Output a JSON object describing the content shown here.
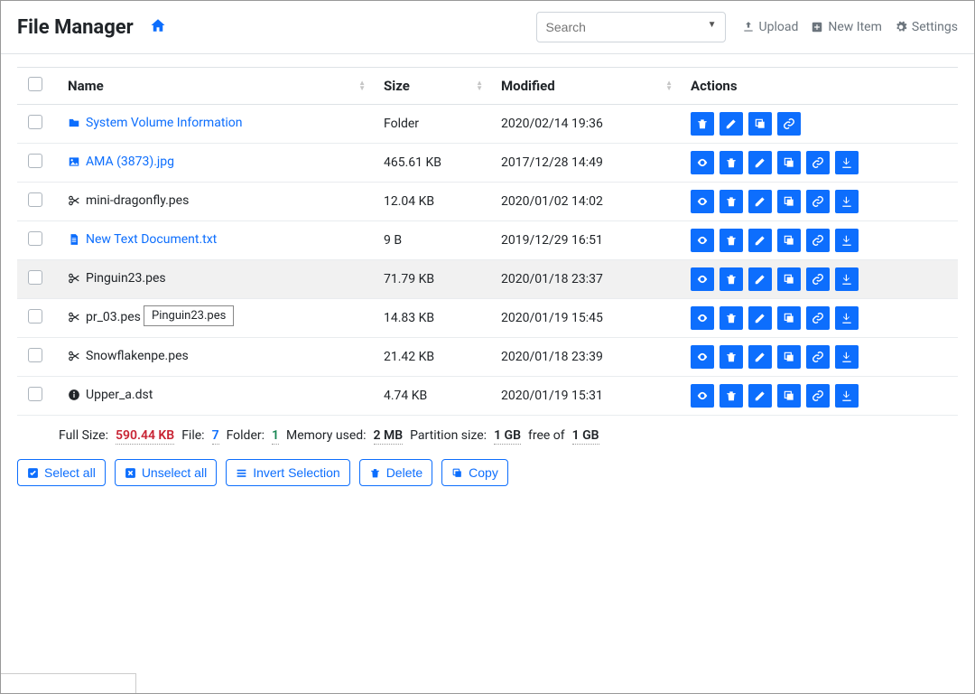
{
  "header": {
    "brand": "File Manager",
    "search_placeholder": "Search",
    "upload": "Upload",
    "new_item": "New Item",
    "settings": "Settings"
  },
  "columns": {
    "name": "Name",
    "size": "Size",
    "modified": "Modified",
    "actions": "Actions"
  },
  "rows": [
    {
      "icon": "folder",
      "link": true,
      "name": "System Volume Information",
      "size": "Folder",
      "modified": "2020/02/14 19:36",
      "actions": [
        "delete",
        "rename",
        "copy",
        "link"
      ]
    },
    {
      "icon": "image",
      "link": true,
      "name": "AMA (3873).jpg",
      "size": "465.61 KB",
      "modified": "2017/12/28 14:49",
      "actions": [
        "preview",
        "delete",
        "rename",
        "copy",
        "link",
        "download"
      ]
    },
    {
      "icon": "scissor",
      "link": false,
      "name": "mini-dragonfly.pes",
      "size": "12.04 KB",
      "modified": "2020/01/02 14:02",
      "actions": [
        "preview",
        "delete",
        "rename",
        "copy",
        "link",
        "download"
      ]
    },
    {
      "icon": "file",
      "link": true,
      "name": "New Text Document.txt",
      "size": "9 B",
      "modified": "2019/12/29 16:51",
      "actions": [
        "preview",
        "delete",
        "rename",
        "copy",
        "link",
        "download"
      ]
    },
    {
      "icon": "scissor",
      "link": false,
      "name": "Pinguin23.pes",
      "size": "71.79 KB",
      "modified": "2020/01/18 23:37",
      "actions": [
        "preview",
        "delete",
        "rename",
        "copy",
        "link",
        "download"
      ],
      "hovered": true
    },
    {
      "icon": "scissor",
      "link": false,
      "name": "pr_03.pes",
      "size": "14.83 KB",
      "modified": "2020/01/19 15:45",
      "actions": [
        "preview",
        "delete",
        "rename",
        "copy",
        "link",
        "download"
      ],
      "tooltip": "Pinguin23.pes"
    },
    {
      "icon": "scissor",
      "link": false,
      "name": "Snowflakenpe.pes",
      "size": "21.42 KB",
      "modified": "2020/01/18 23:39",
      "actions": [
        "preview",
        "delete",
        "rename",
        "copy",
        "link",
        "download"
      ]
    },
    {
      "icon": "info",
      "link": false,
      "name": "Upper_a.dst",
      "size": "4.74 KB",
      "modified": "2020/01/19 15:31",
      "actions": [
        "preview",
        "delete",
        "rename",
        "copy",
        "link",
        "download"
      ]
    }
  ],
  "summary": {
    "full_size_label": "Full Size:",
    "full_size": "590.44 KB",
    "file_label": "File:",
    "file_count": "7",
    "folder_label": "Folder:",
    "folder_count": "1",
    "memory_label": "Memory used:",
    "memory": "2 MB",
    "partition_label": "Partition size:",
    "partition_free": "1 GB",
    "free_of": "free of",
    "partition_total": "1 GB"
  },
  "bulk": {
    "select_all": "Select all",
    "unselect_all": "Unselect all",
    "invert": "Invert Selection",
    "delete": "Delete",
    "copy": "Copy"
  }
}
